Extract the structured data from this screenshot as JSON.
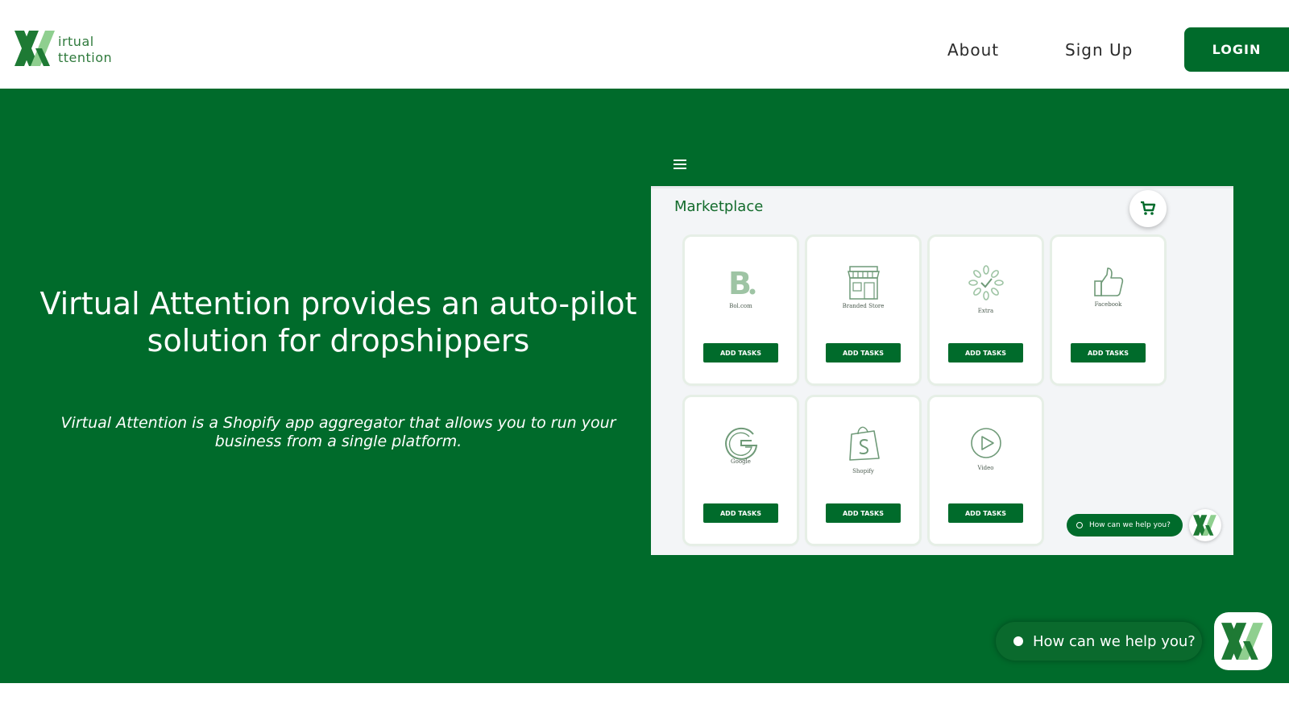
{
  "brand": {
    "logo_line1": "irtual",
    "logo_line2": "ttention",
    "primary_color": "#006b2b",
    "accent_light": "#8fcf8f"
  },
  "nav": {
    "about": "About",
    "signup": "Sign Up",
    "login": "LOGIN"
  },
  "hero": {
    "title": "Virtual Attention provides an auto-pilot solution for dropshippers",
    "subtitle": "Virtual Attention is a Shopify app aggregator that allows you to run your business from a single platform."
  },
  "mockup": {
    "menu_icon": "hamburger-icon",
    "title": "Marketplace",
    "cart_icon": "cart-icon",
    "cards": [
      {
        "label": "Bol.com",
        "icon": "bol-logo-icon",
        "button": "ADD TASKS"
      },
      {
        "label": "Branded Store",
        "icon": "store-icon",
        "button": "ADD TASKS"
      },
      {
        "label": "Extra",
        "icon": "loading-icon",
        "button": "ADD TASKS"
      },
      {
        "label": "Facebook",
        "icon": "thumbs-up-icon",
        "button": "ADD TASKS"
      },
      {
        "label": "Google",
        "icon": "google-icon",
        "button": "ADD TASKS"
      },
      {
        "label": "Shopify",
        "icon": "shopify-bag-icon",
        "button": "ADD TASKS"
      },
      {
        "label": "Video",
        "icon": "play-icon",
        "button": "ADD TASKS"
      }
    ],
    "chat_label": "How can we help you?"
  },
  "chat_widget": {
    "label": "How can we help you?",
    "avatar_icon": "brand-logo-icon"
  }
}
